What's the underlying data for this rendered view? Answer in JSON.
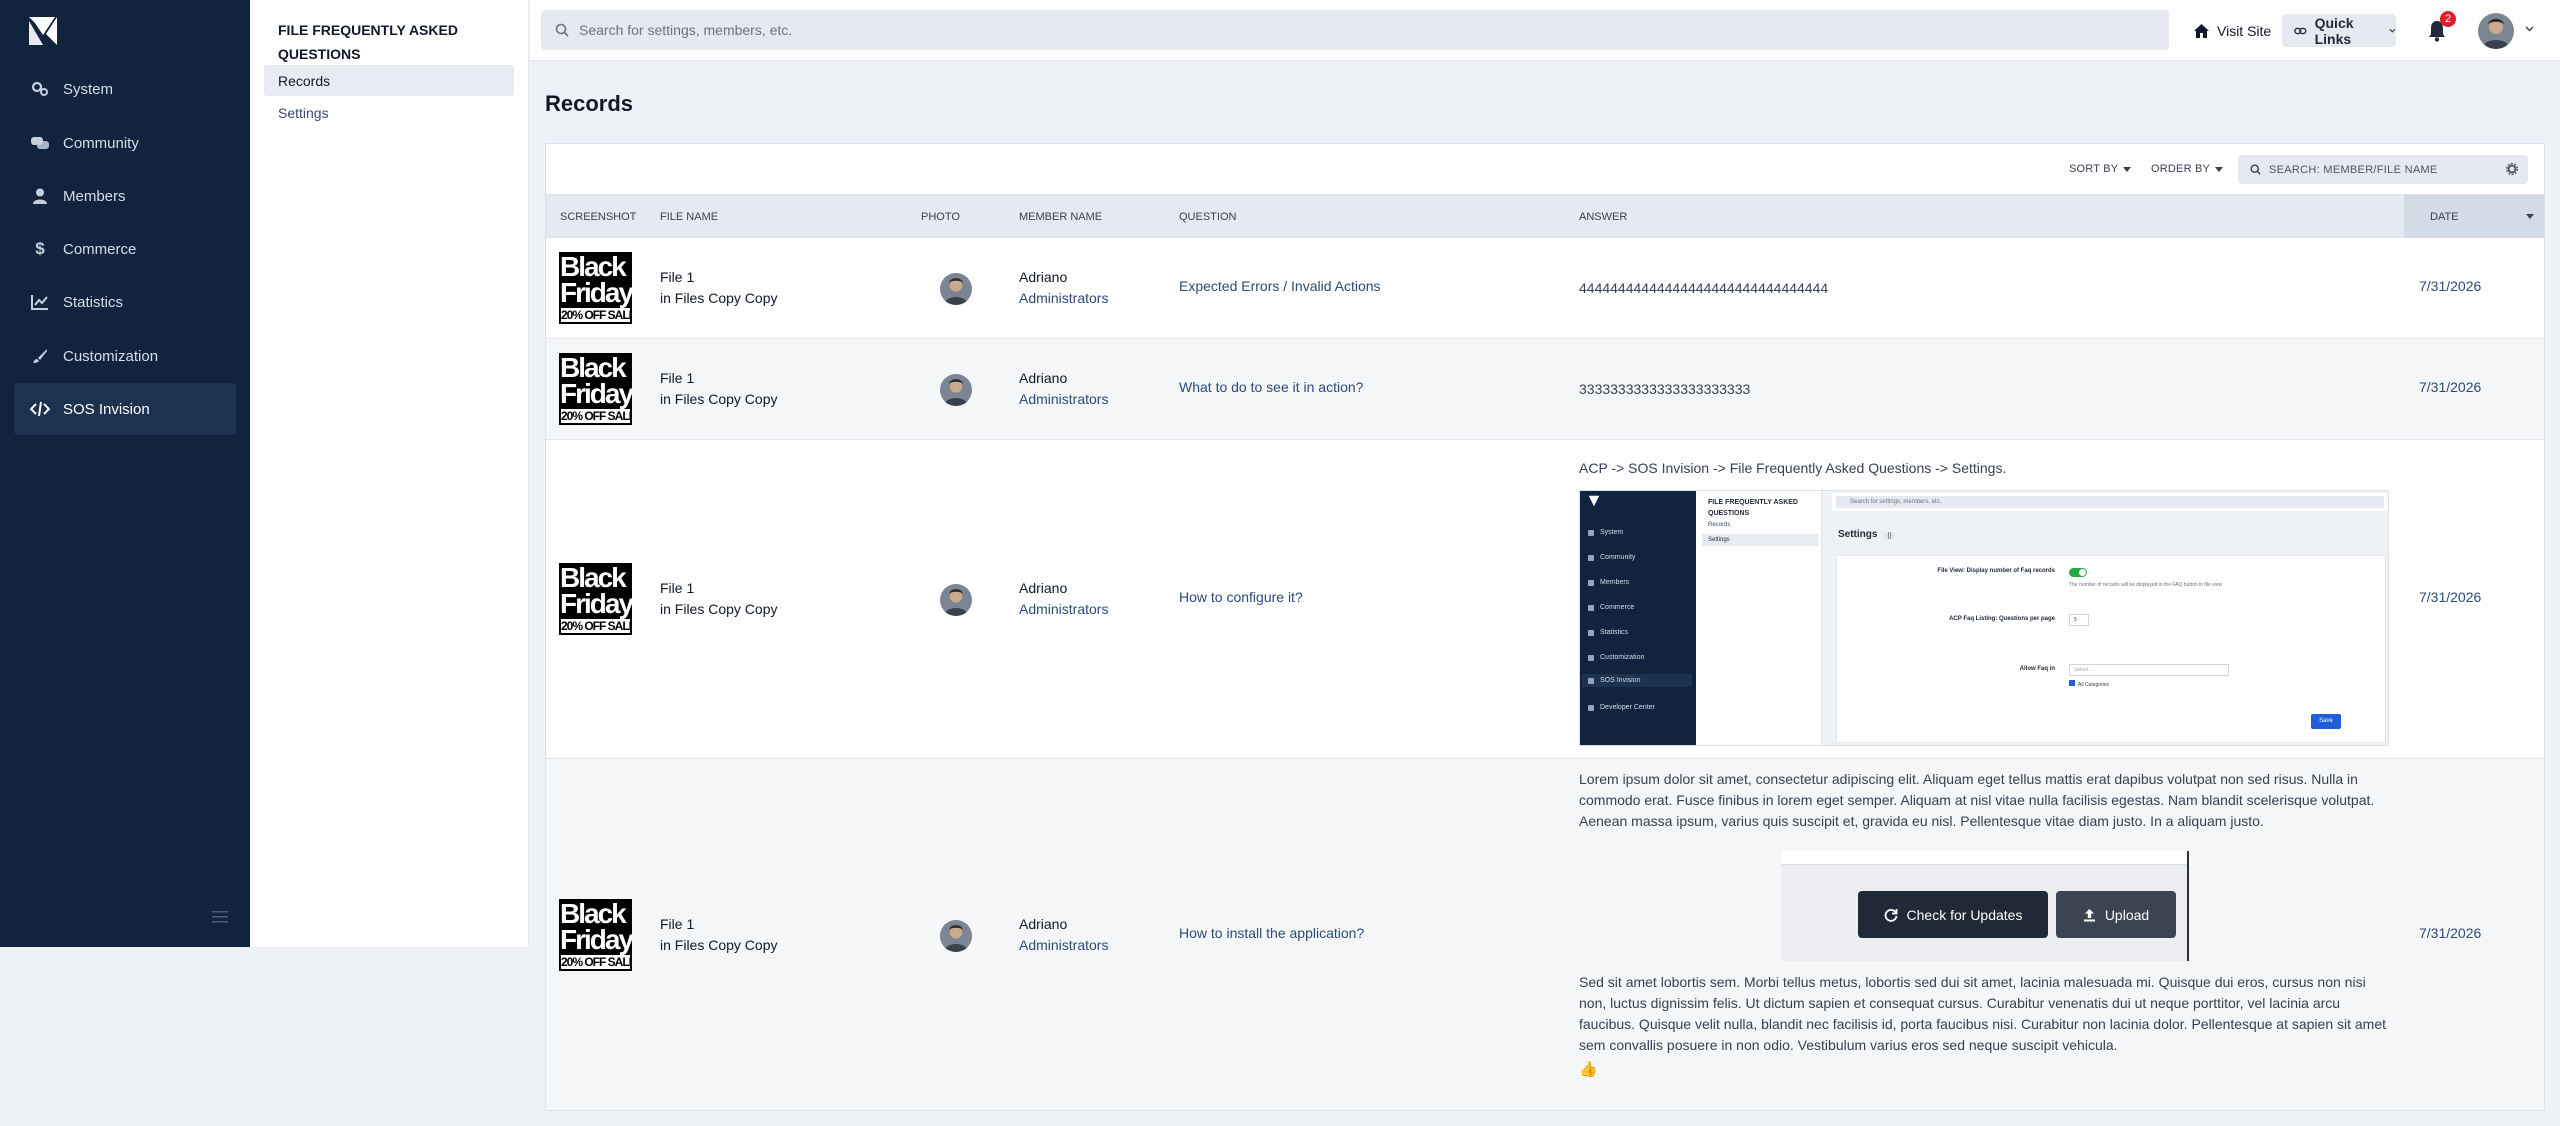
{
  "sidebar": {
    "items": [
      {
        "label": "System",
        "icon": "gears-icon"
      },
      {
        "label": "Community",
        "icon": "comments-icon"
      },
      {
        "label": "Members",
        "icon": "user-icon"
      },
      {
        "label": "Commerce",
        "icon": "dollar-icon"
      },
      {
        "label": "Statistics",
        "icon": "chart-line-icon"
      },
      {
        "label": "Customization",
        "icon": "brush-icon"
      },
      {
        "label": "SOS Invision",
        "icon": "code-icon",
        "active": true
      }
    ]
  },
  "subnav": {
    "title": "File Frequently Asked Questions",
    "items": [
      {
        "label": "Records",
        "active": true
      },
      {
        "label": "Settings"
      }
    ]
  },
  "topbar": {
    "search_placeholder": "Search for settings, members, etc.",
    "visit_site": "Visit Site",
    "quick_links": "Quick Links",
    "notification_count": "2"
  },
  "page": {
    "title": "Records"
  },
  "toolbar": {
    "sort_by": "Sort By",
    "order_by": "Order By",
    "search_placeholder": "Search: Member/File Name"
  },
  "table": {
    "columns": [
      "Screenshot",
      "File Name",
      "Photo",
      "Member Name",
      "Question",
      "Answer",
      "Date"
    ],
    "rows": [
      {
        "screenshot": {
          "l1": "Black",
          "l2": "Friday",
          "l3": "20% OFF SALE"
        },
        "file_name": "File 1",
        "file_location": "in Files Copy Copy",
        "member_name": "Adriano",
        "member_group": "Administrators",
        "question": "Expected Errors / Invalid Actions",
        "answer": "44444444444444444444444444444444",
        "date": "7/31/2026"
      },
      {
        "screenshot": {
          "l1": "Black",
          "l2": "Friday",
          "l3": "20% OFF SALE"
        },
        "file_name": "File 1",
        "file_location": "in Files Copy Copy",
        "member_name": "Adriano",
        "member_group": "Administrators",
        "question": "What to do to see it in action?",
        "answer": "3333333333333333333333",
        "date": "7/31/2026"
      },
      {
        "screenshot": {
          "l1": "Black",
          "l2": "Friday",
          "l3": "20% OFF SALE"
        },
        "file_name": "File 1",
        "file_location": "in Files Copy Copy",
        "member_name": "Adriano",
        "member_group": "Administrators",
        "question": "How to configure it?",
        "answer": "ACP -> SOS Invision -> File Frequently Asked Questions -> Settings.",
        "date": "7/31/2026",
        "embedded": {
          "nav": [
            "System",
            "Community",
            "Members",
            "Commerce",
            "Statistics",
            "Customization",
            "SOS Invision",
            "Developer Center"
          ],
          "sub_title": "FILE FREQUENTLY ASKED QUESTIONS",
          "sub_items": [
            "Records",
            "Settings"
          ],
          "search_placeholder": "Search for settings, members, etc.",
          "heading": "Settings",
          "heading_tag": "{}",
          "label_1": "File View: Display number of Faq records",
          "note_1": "The number of records will be displayed in the FAQ button in file view",
          "label_2": "ACP Faq Listing: Questions per page",
          "input_2": "5",
          "label_3": "Allow Faq in",
          "placeholder_3": "Select...",
          "check_3": "All Categories",
          "lang_tag": "{}",
          "save": "Save"
        }
      },
      {
        "screenshot": {
          "l1": "Black",
          "l2": "Friday",
          "l3": "20% OFF SALE"
        },
        "file_name": "File 1",
        "file_location": "in Files Copy Copy",
        "member_name": "Adriano",
        "member_group": "Administrators",
        "question": "How to install the application?",
        "answer_p1": "Lorem ipsum dolor sit amet, consectetur adipiscing elit. Aliquam eget tellus mattis erat dapibus volutpat non sed risus. Nulla in commodo erat. Fusce finibus in lorem eget semper. Aliquam at nisl vitae nulla facilisis egestas. Nam blandit scelerisque volutpat. Aenean massa ipsum, varius quis suscipit et, gravida eu nisl. Pellentesque vitae diam justo. In a aliquam justo.",
        "answer_btn_1": "Check for Updates",
        "answer_btn_2": "Upload",
        "answer_p2": "Sed sit amet lobortis sem. Morbi tellus metus, lobortis sed dui sit amet, lacinia malesuada mi. Quisque dui eros, cursus non nisi non, luctus dignissim felis. Ut dictum sapien et consequat cursus. Curabitur venenatis dui ut neque porttitor, vel lacinia arcu faucibus. Quisque velit nulla, blandit nec facilisis id, porta faucibus nisi. Curabitur non lacinia dolor. Pellentesque at sapien sit amet sem convallis posuere in non odio. Vestibulum varius eros sed neque suscipit vehicula.",
        "answer_emoji": "👍",
        "date": "7/31/2026"
      }
    ]
  },
  "colors": {
    "sidebar_bg": "#11233d",
    "accent_link": "#2c4a7a",
    "badge": "#e11d2b"
  }
}
